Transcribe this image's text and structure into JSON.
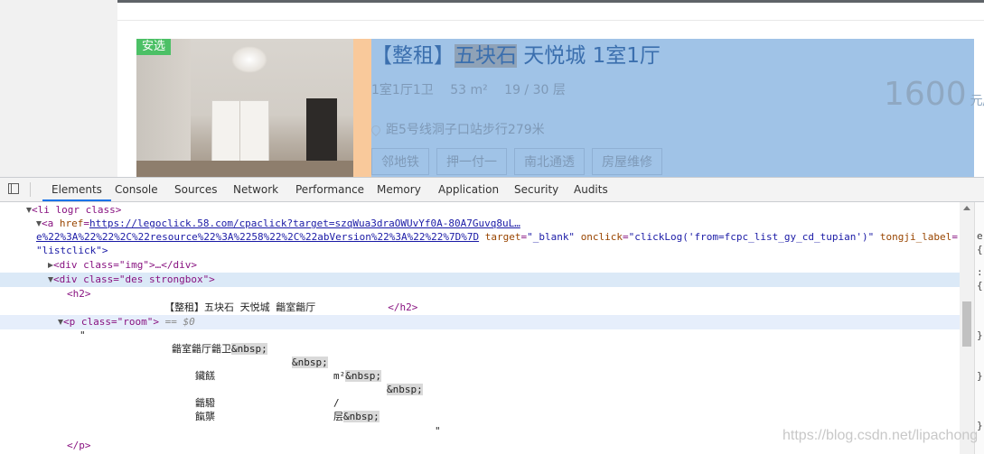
{
  "listing": {
    "badge": "安选",
    "title_prefix": "【整租】",
    "title_keyword": "五块石",
    "title_rest": " 天悦城 1室1厅",
    "room_layout": "1室1厅1卫",
    "area": "53 m²",
    "floor": "19 / 30 层",
    "address": "距5号线洞子口站步行279米",
    "tags": [
      "邻地铁",
      "押一付一",
      "南北通透",
      "房屋维修"
    ],
    "price": "1600",
    "price_unit": "元/月"
  },
  "devtools": {
    "tabs": [
      "Elements",
      "Console",
      "Sources",
      "Network",
      "Performance",
      "Memory",
      "Application",
      "Security",
      "Audits"
    ],
    "active_tab": "Elements",
    "code": {
      "l1_tag": "<li logr class>",
      "l2_open": "<a ",
      "l2_href_attr": "href",
      "l2_href_val": "https://legoclick.58.com/cpaclick?target=szqWua3draOWUvYf0A-80A7Guvq8uL…",
      "l3_url": "e%22%3A%22%22%2C%22resource%22%3A%2258%22%2C%22abVersion%22%3A%22%22%7D%7D",
      "l3_rest_target_attr": "target",
      "l3_rest_target_val": "\"_blank\"",
      "l3_onclick_attr": "onclick",
      "l3_onclick_val": "\"clickLog('from=fcpc_list_gy_cd_tupian')\"",
      "l3_tongji_attr": "tongji_label",
      "l4_val": "\"listclick\">",
      "l5_div_img": "<div class=\"img\">…</div>",
      "l6_div_des": "<div class=\"des strongbox\">",
      "l7_h2": "<h2>",
      "l8_h2_text": "【整租】五块石 天悦城 龤室龤厅",
      "l8_h2_close": "</h2>",
      "l9_p": "<p class=\"room\">",
      "l9_eq": " == $0",
      "l10_quote": "\"",
      "l11_text": "龤室龤厅龤卫",
      "l11_nbsp": "&nbsp;",
      "l12_nbsp": "&nbsp;",
      "l13_text": "鑶餻",
      "l13_m2": "m²",
      "l13_nbsp": "&nbsp;",
      "l14_nbsp": "&nbsp;",
      "l15_text": "龤驋",
      "l15_slash": "/",
      "l16_text": "餼龒",
      "l16_ceng": "层",
      "l16_nbsp": "&nbsp;",
      "l17_quote": "\"",
      "l18_p_close": "</p>"
    },
    "side": [
      "e",
      "{",
      ":",
      "{",
      "}",
      "}",
      "}"
    ]
  },
  "watermark": "https://blog.csdn.net/lipachong"
}
